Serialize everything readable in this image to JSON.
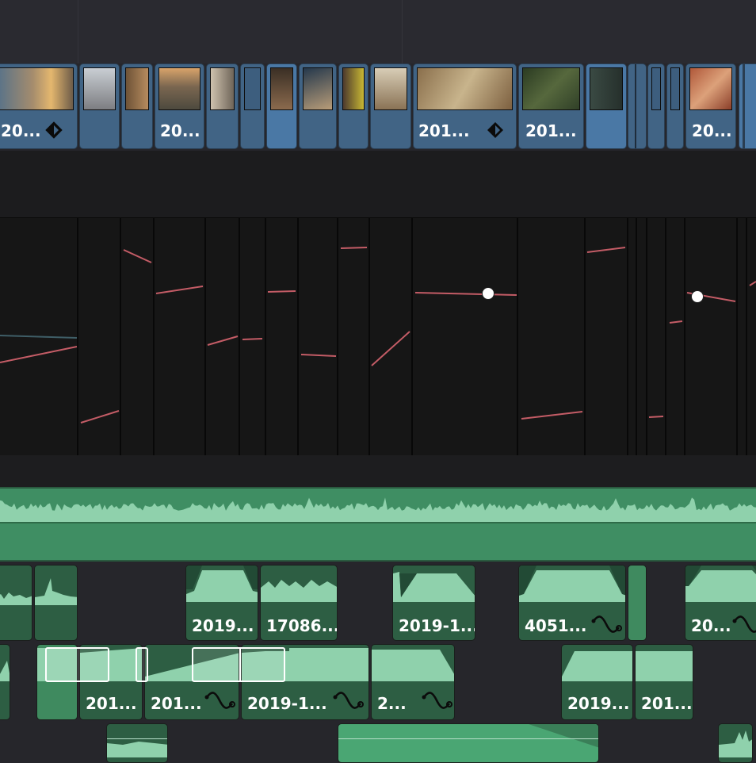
{
  "colors": {
    "video_clip": "#416485",
    "video_clip_selected": "#4a78a5",
    "audio_clip": "#3f8a5f",
    "audio_wave": "#8fd1ac",
    "curve_line": "#c45c66",
    "panel_bg": "#161616"
  },
  "icons": {
    "keyframe": "diamond-half-filled-icon",
    "fade_curve": "sine-curve-icon"
  },
  "video_track": {
    "clips": [
      {
        "label": "20...",
        "has_keyframe": true
      },
      {
        "label": ""
      },
      {
        "label": ""
      },
      {
        "label": "20..."
      },
      {
        "label": ""
      },
      {
        "label": ""
      },
      {
        "label": ""
      },
      {
        "label": ""
      },
      {
        "label": ""
      },
      {
        "label": ""
      },
      {
        "label": "201...",
        "has_keyframe": true
      },
      {
        "label": "201..."
      },
      {
        "label": ""
      },
      {
        "label": ""
      },
      {
        "label": ""
      },
      {
        "label": ""
      },
      {
        "label": "20..."
      }
    ]
  },
  "audio_tracks": {
    "track2": {
      "clips": [
        {
          "label": ""
        },
        {
          "label": ""
        },
        {
          "label": "2019..."
        },
        {
          "label": "17086..."
        },
        {
          "label": "2019-1..."
        },
        {
          "label": "4051...",
          "has_fade_icon": true
        },
        {
          "label": ""
        },
        {
          "label": "20...",
          "has_fade_icon": true
        }
      ]
    },
    "track3": {
      "clips": [
        {
          "label": ""
        },
        {
          "label": ""
        },
        {
          "label": "201..."
        },
        {
          "label": "201...",
          "has_fade_icon": true
        },
        {
          "label": "2019-1...",
          "has_fade_icon": true
        },
        {
          "label": "2...",
          "has_fade_icon": true
        },
        {
          "label": "2019..."
        },
        {
          "label": "201..."
        }
      ]
    }
  }
}
